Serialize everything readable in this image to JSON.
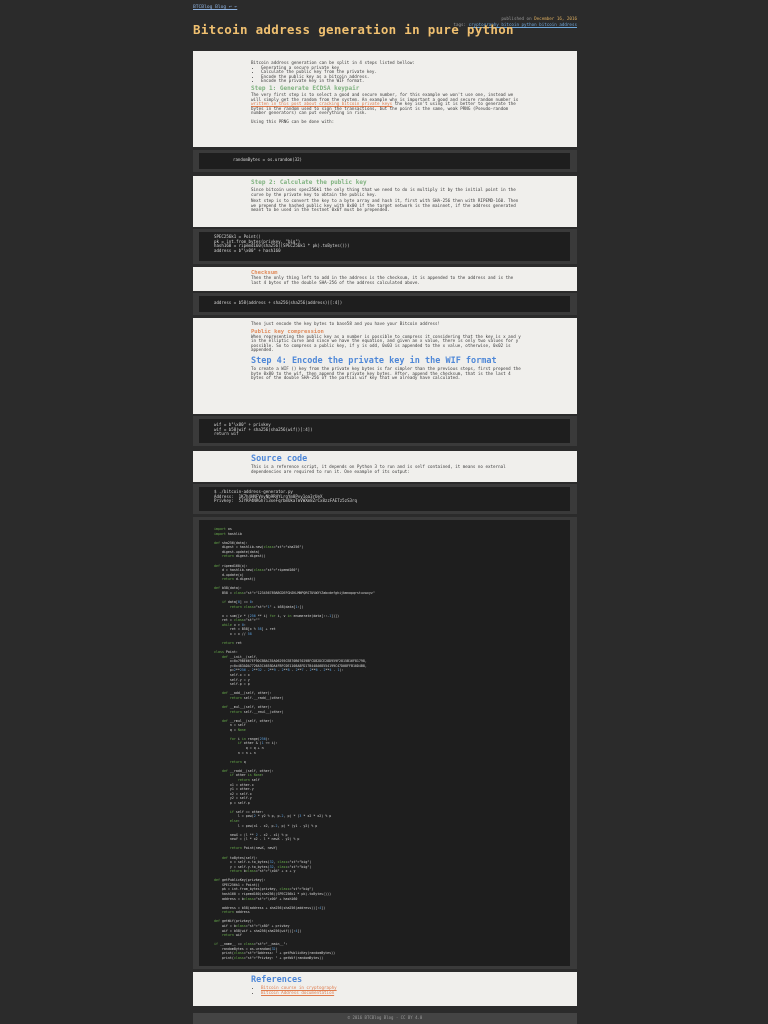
{
  "nav": {
    "back": "BTCBlog Blog ↩ ←"
  },
  "meta": {
    "published": "published on",
    "date": "December 16, 2016",
    "tags_label": "tags:",
    "tags": "cryptography bitcoin python bitcoin address"
  },
  "title": "Bitcoin address generation in pure python",
  "intro": {
    "lead": "Bitcoin address generation can be split in 4 steps listed bellow:",
    "steps": [
      "Generating a secure private key",
      "Calculate the public key from the private key.",
      "Encode the public key as a bitcoin address.",
      "Encode the private key in the WIF format."
    ],
    "step1_head": "Step 1: Generate ECDSA keypair",
    "step1_text": "The very first step is to select a good and secure number, for this example we won't use one, instead we will simply get the random from the system. An example why is important a good and secure random number is",
    "step1_link": "written in this post about cracking bitcoin private keys",
    "step1_text2": "the key isn't using it is better to generate the bytes in the random used to sign the transactions, but the point is the same, weak PRNG (Pseudo-random number generators) can put everything in risk.",
    "prng": "Using this PRNG can be done with:"
  },
  "code1": "randomBytes = os.urandom(32)",
  "step2": {
    "head": "Step 2: Calculate the public key",
    "p1": "Since bitcoin uses spec256k1 the only thing that we need to do is multiply it by the initial point in the curve by the private key to obtain the public key.",
    "p2": "Next step is to convert the key to a byte array and hash it, first with SHA-256 then with RIPEMD-160. Then we prepend the hashed public key with 0x00 if the target network is the mainnet, if the address generated meant to be used in the testnet 0x6f must be prepended."
  },
  "code2": [
    "SPEC256k1 = Point()",
    "pk = int.from_bytes(privkey, \"big\")",
    "hash160 = ripemd160(sha256((SPEC256k1 * pk).toBytes()))",
    "address = b\"\\x00\" + hash160"
  ],
  "checksum": {
    "head": "Checksum",
    "text": "Then the only thing left to add in the address is the checksum, it is appended to the address and is the last 4 bytes of the double SHA-256 of the address calculated above."
  },
  "code3": "address = b58(address + sha256(sha256(address))[:4])",
  "step3": {
    "p1": "Then just encode the key bytes to base58 and you have your Bitcoin address!",
    "comp_head": "Public key compression",
    "comp_text": "When representing the public key as a number is possible to compress it considering that the key is x and y in the elliptic curve and since we have the equation, and given an x value, there is only two values for y possible. So to compress a public key, if y is odd, 0x03 is appended to the x value, otherwise, 0x02 is appended.",
    "step4_head": "Step 4: Encode the private key in the WIF format",
    "step4_text": "To create a WIF () key from the private key bytes is far simpler than the previous steps, first prepend the byte 0x80 to the wif, then append the private key bytes. After, append the checksum, that is the last 4 bytes of the double SHA-256 of the partial wif key that we already have calculated."
  },
  "code4": [
    "wif = b\"\\x80\" + privkey",
    "wif = b58(wif + sha256(sha256(wif))[:4])",
    "return wif"
  ],
  "source": {
    "head": "Source code",
    "text": "This is a reference script, it depends on Python 3 to run and is self contained, it means no external dependencies are required to run it. One example of its output:"
  },
  "code5": [
    "$ ./bitcoin-address-generator.py",
    "Address:  1K7h4HNFVnvNb9RHYLrgYm8Pvy1oa3rUeX",
    "Privkey:  5JYRP4NRGh7i3xeFqrbmUkaTmVWXm8ZrCx8zzFAETz5zS3rq"
  ],
  "code6": [
    "import os",
    "import hashlib",
    "",
    "def sha256(data):",
    "    digest = hashlib.new(\"sha256\")",
    "    digest.update(data)",
    "    return digest.digest()",
    "",
    "def ripemd160(x):",
    "    d = hashlib.new(\"ripemd160\")",
    "    d.update(x)",
    "    return d.digest()",
    "",
    "def b58(data):",
    "    B58 = \"123456789ABCDEFGHJKLMNPQRSTUVWXYZabcdefghijkmnopqrstuvwxyz\"",
    "",
    "    if data[0] == 0:",
    "        return \"1\" + b58(data[1:])",
    "",
    "    x = sum([v * (256 ** i) for i, v in enumerate(data[::-1])])",
    "    ret = \"\"",
    "    while x > 0:",
    "        ret = B58[x % 58] + ret",
    "        x = x // 58",
    "",
    "    return ret",
    "",
    "class Point:",
    "    def __init__(self,",
    "        x=0x79BE667EF9DCBBAC55A06295CE870B07029BFCDB2DCE28D959F2815B16F81798,",
    "        y=0x483ADA7726A3C4655DA4FBFC0E1108A8FD17B448A68554199C47D08FFB10D4B8,",
    "        p=2**256 - 2**32 - 2**9 - 2**8 - 2**7 - 2**6 - 2**4 - 1):",
    "        self.x = x",
    "        self.y = y",
    "        self.p = p",
    "",
    "    def __add__(self, other):",
    "        return self.__radd__(other)",
    "",
    "    def __mul__(self, other):",
    "        return self.__rmul__(other)",
    "",
    "    def __rmul__(self, other):",
    "        n = self",
    "        q = None",
    "",
    "        for i in range(256):",
    "            if other & (1 << i):",
    "                q = q + n",
    "            n = n + n",
    "",
    "        return q",
    "",
    "    def __radd__(self, other):",
    "        if other is None:",
    "            return self",
    "        x1 = other.x",
    "        y1 = other.y",
    "        x2 = self.x",
    "        y2 = self.y",
    "        p = self.p",
    "",
    "        if self == other:",
    "            l = pow(2 * y2 % p, p-2, p) * (3 * x2 * x2) % p",
    "        else:",
    "            l = pow(x1 - x2, p-2, p) * (y1 - y2) % p",
    "",
    "        newX = (l ** 2 - x2 - x1) % p",
    "        newY = (l * x2 - l * newX - y2) % p",
    "",
    "        return Point(newX, newY)",
    "",
    "    def toBytes(self):",
    "        x = self.x.to_bytes(32, \"big\")",
    "        y = self.y.to_bytes(32, \"big\")",
    "        return b\"\\x04\" + x + y",
    "",
    "def getPublicKey(privkey):",
    "    SPEC256k1 = Point()",
    "    pk = int.from_bytes(privkey, \"big\")",
    "    hash160 = ripemd160(sha256((SPEC256k1 * pk).toBytes()))",
    "    address = b\"\\x00\" + hash160",
    "",
    "    address = b58(address + sha256(sha256(address))[:4])",
    "    return address",
    "",
    "def getWif(privkey):",
    "    wif = b\"\\x80\" + privkey",
    "    wif = b58(wif + sha256(sha256(wif))[:4])",
    "    return wif",
    "",
    "if __name__ == \"__main__\":",
    "    randomBytes = os.urandom(32)",
    "    print(\"Address: \" + getPublicKey(randomBytes))",
    "    print(\"Privkey: \" + getWif(randomBytes))"
  ],
  "refs": {
    "head": "References",
    "items": [
      "Bitcoin course in cryptography",
      "Bitcoin Address documentation"
    ]
  },
  "footer": "© 2016 BTCBlog Blog · CC BY 4.0"
}
